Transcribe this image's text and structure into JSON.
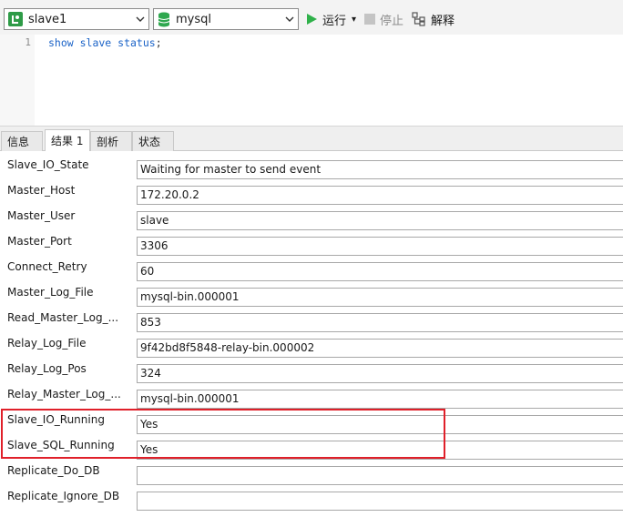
{
  "toolbar": {
    "connection": "slave1",
    "database": "mysql",
    "run_label": "运行",
    "stop_label": "停止",
    "explain_label": "解释",
    "run_dropdown": "▾"
  },
  "editor": {
    "line_number": "1",
    "code_keywords": "show slave status",
    "code_end": ";"
  },
  "tabs": [
    {
      "label": "信息"
    },
    {
      "label": "结果 1"
    },
    {
      "label": "剖析"
    },
    {
      "label": "状态"
    }
  ],
  "active_tab": "结果 1",
  "fields": [
    {
      "name": "Slave_IO_State",
      "value": "Waiting for master to send event"
    },
    {
      "name": "Master_Host",
      "value": "172.20.0.2"
    },
    {
      "name": "Master_User",
      "value": "slave"
    },
    {
      "name": "Master_Port",
      "value": "3306"
    },
    {
      "name": "Connect_Retry",
      "value": "60"
    },
    {
      "name": "Master_Log_File",
      "value": "mysql-bin.000001"
    },
    {
      "name": "Read_Master_Log_...",
      "value": "853"
    },
    {
      "name": "Relay_Log_File",
      "value": "9f42bd8f5848-relay-bin.000002"
    },
    {
      "name": "Relay_Log_Pos",
      "value": "324"
    },
    {
      "name": "Relay_Master_Log_...",
      "value": "mysql-bin.000001"
    },
    {
      "name": "Slave_IO_Running",
      "value": "Yes"
    },
    {
      "name": "Slave_SQL_Running",
      "value": "Yes"
    },
    {
      "name": "Replicate_Do_DB",
      "value": ""
    },
    {
      "name": "Replicate_Ignore_DB",
      "value": ""
    }
  ],
  "colors": {
    "highlight": "#e0202a",
    "run_icon": "#2fb14a",
    "sql_keyword": "#1b63c7"
  }
}
